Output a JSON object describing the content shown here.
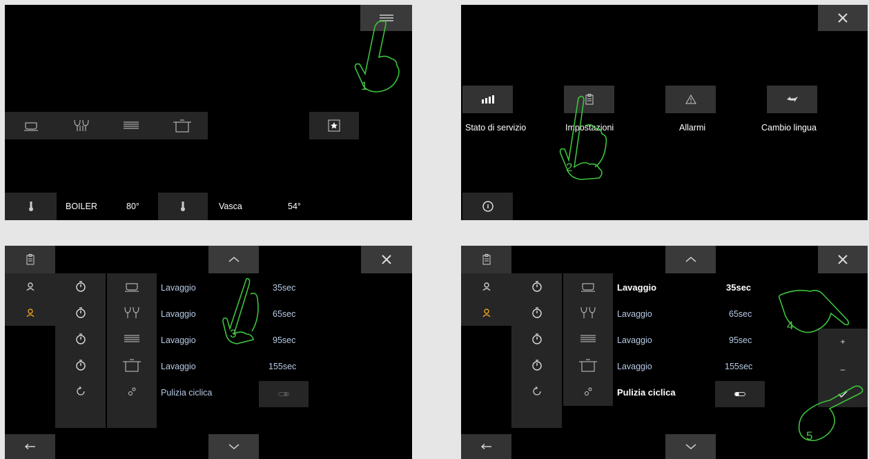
{
  "screen1": {
    "boiler_label": "BOILER",
    "boiler_temp": "80°",
    "tank_label": "Vasca",
    "tank_temp": "54°",
    "step": "1"
  },
  "screen2": {
    "items": [
      {
        "label": "Stato di servizio",
        "icon": "signal-bars-icon"
      },
      {
        "label": "Impostazioni",
        "icon": "clipboard-icon"
      },
      {
        "label": "Allarmi",
        "icon": "warning-icon"
      },
      {
        "label": "Cambio lingua",
        "icon": "language-icon"
      }
    ],
    "step": "2"
  },
  "screen3": {
    "rows": [
      {
        "label": "Lavaggio",
        "value": "35sec",
        "icon": "cup-icon"
      },
      {
        "label": "Lavaggio",
        "value": "65sec",
        "icon": "glasses-icon"
      },
      {
        "label": "Lavaggio",
        "value": "95sec",
        "icon": "plates-icon"
      },
      {
        "label": "Lavaggio",
        "value": "155sec",
        "icon": "pot-icon"
      }
    ],
    "cyclic_label": "Pulizia ciclica",
    "step": "3"
  },
  "screen4": {
    "rows": [
      {
        "label": "Lavaggio",
        "value": "35sec",
        "icon": "cup-icon"
      },
      {
        "label": "Lavaggio",
        "value": "65sec",
        "icon": "glasses-icon"
      },
      {
        "label": "Lavaggio",
        "value": "95sec",
        "icon": "plates-icon"
      },
      {
        "label": "Lavaggio",
        "value": "155sec",
        "icon": "pot-icon"
      }
    ],
    "cyclic_label": "Pulizia ciclica",
    "plus_label": "+",
    "minus_label": "–",
    "step4": "4",
    "step5": "5"
  },
  "colors": {
    "panel": "#000000",
    "tile": "#333333",
    "accent_orange": "#e8a020",
    "hand_green": "#3cc43c",
    "value_blue": "#b9cbe6"
  }
}
